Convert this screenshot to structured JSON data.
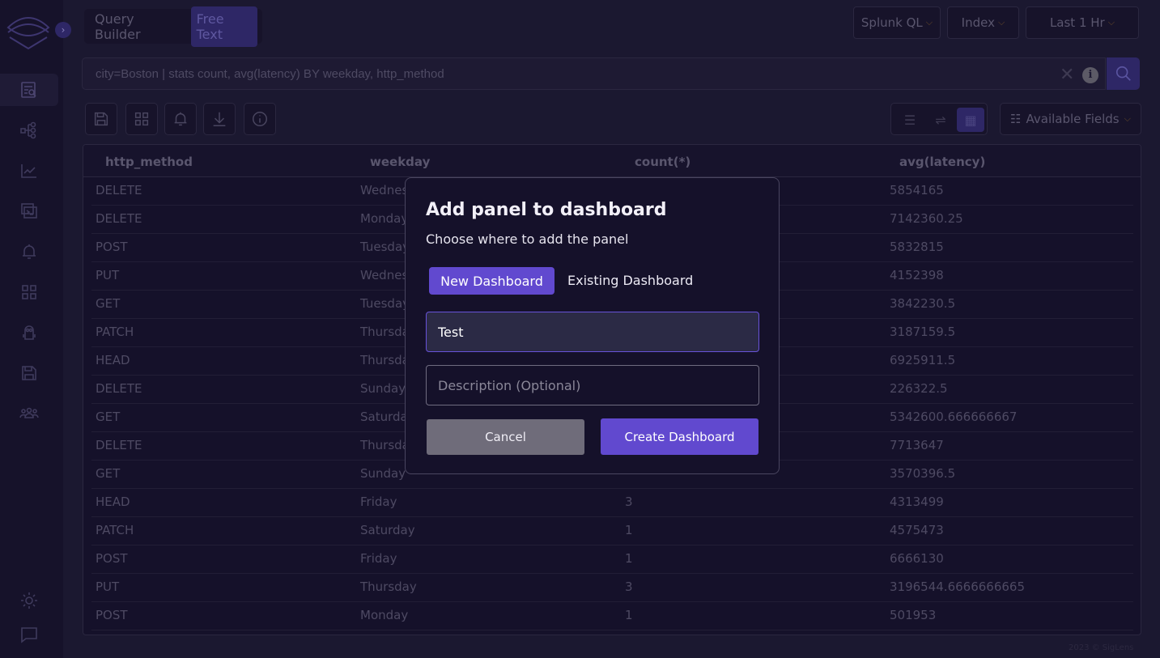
{
  "header": {
    "tabs": [
      {
        "label": "Query Builder",
        "active": false
      },
      {
        "label": "Free Text",
        "active": true
      }
    ],
    "query_language": "Splunk QL",
    "index": "Index",
    "time_range": "Last 1 Hr",
    "query": "city=Boston | stats count, avg(latency) BY weekday, http_method",
    "available_fields": "Available Fields"
  },
  "sidebar": {
    "icons": [
      "search-logs-icon",
      "service-map-icon",
      "metrics-icon",
      "dashboards-icon",
      "alerts-icon",
      "grid-icon",
      "minion-icon",
      "saved-queries-icon",
      "users-icon",
      "theme-sun-icon",
      "chat-icon"
    ]
  },
  "table": {
    "columns": [
      "http_method",
      "weekday",
      "count(*)",
      "avg(latency)"
    ],
    "rows": [
      [
        "DELETE",
        "Wednes",
        "",
        "5854165"
      ],
      [
        "DELETE",
        "Monday",
        "",
        "7142360.25"
      ],
      [
        "POST",
        "Tuesday",
        "",
        "5832815"
      ],
      [
        "PUT",
        "Wednes",
        "",
        "4152398"
      ],
      [
        "GET",
        "Tuesday",
        "",
        "3842230.5"
      ],
      [
        "PATCH",
        "Thursda",
        "",
        "3187159.5"
      ],
      [
        "HEAD",
        "Thursda",
        "",
        "6925911.5"
      ],
      [
        "DELETE",
        "Sunday",
        "",
        "226322.5"
      ],
      [
        "GET",
        "Saturda",
        "",
        "5342600.666666667"
      ],
      [
        "DELETE",
        "Thursda",
        "",
        "7713647"
      ],
      [
        "GET",
        "Sunday",
        "",
        "3570396.5"
      ],
      [
        "HEAD",
        "Friday",
        "3",
        "4313499"
      ],
      [
        "PATCH",
        "Saturday",
        "1",
        "4575473"
      ],
      [
        "POST",
        "Friday",
        "1",
        "6666130"
      ],
      [
        "PUT",
        "Thursday",
        "3",
        "3196544.6666666665"
      ],
      [
        "POST",
        "Monday",
        "1",
        "501953"
      ]
    ]
  },
  "footer": "2023 © SigLens",
  "modal": {
    "title": "Add panel to dashboard",
    "subtitle": "Choose where to add the panel",
    "new_dashboard": "New Dashboard",
    "existing_dashboard": "Existing Dashboard",
    "name_value": "Test",
    "description_placeholder": "Description (Optional)",
    "cancel": "Cancel",
    "create": "Create Dashboard"
  },
  "colors": {
    "accent": "#6149cf",
    "background": "#1b1830",
    "modal_bg": "#15112a"
  }
}
